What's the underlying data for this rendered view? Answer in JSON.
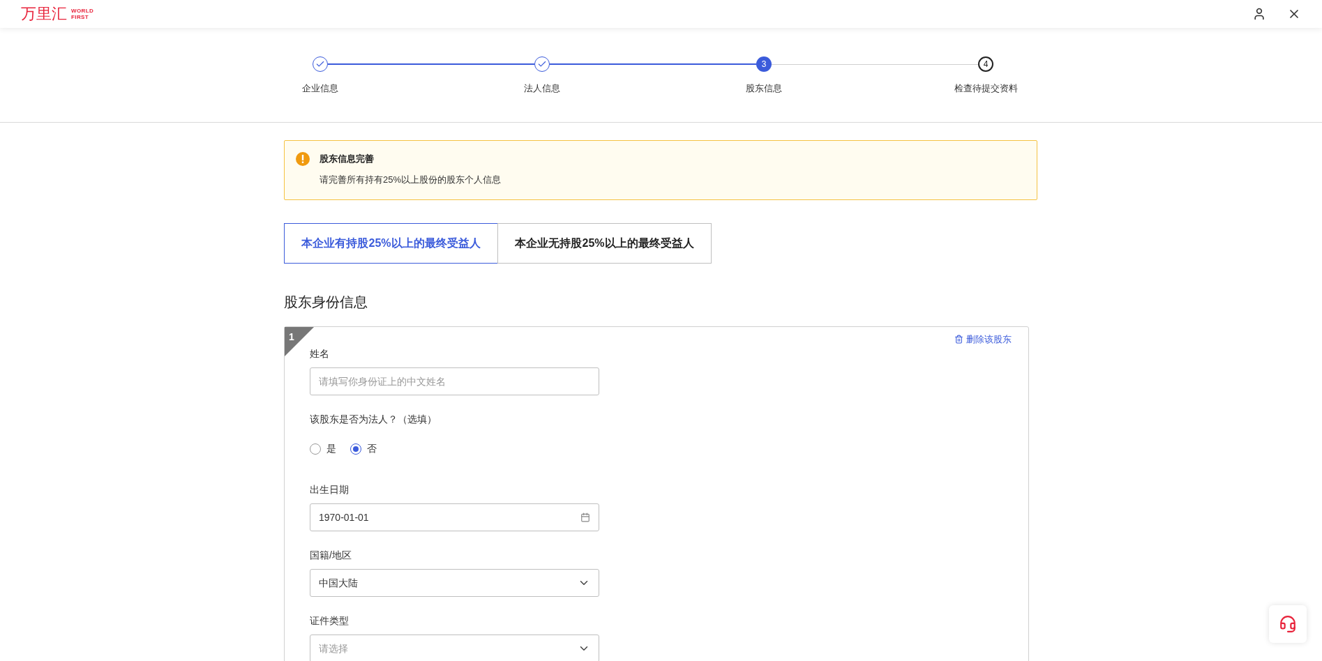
{
  "header": {
    "logo": "万里汇",
    "logo_sub": [
      "WORLD",
      "FIRST"
    ]
  },
  "steps": [
    {
      "label": "企业信息",
      "done": true,
      "selected": false
    },
    {
      "label": "法人信息",
      "done": true,
      "selected": false
    },
    {
      "number": "3",
      "label": "股东信息",
      "done": false,
      "selected": true
    },
    {
      "number": "4",
      "label": "检查待提交资料",
      "done": false,
      "selected": false
    }
  ],
  "alert": {
    "title": "股东信息完善",
    "message": "请完善所有持有25%以上股份的股东个人信息"
  },
  "tabs": [
    {
      "label": "本企业有持股25%以上的最终受益人",
      "selected": true
    },
    {
      "label": "本企业无持股25%以上的最终受益人",
      "selected": false
    }
  ],
  "section_title": "股东身份信息",
  "shareholder": {
    "index": "1",
    "delete_label": "删除该股东",
    "fields": [
      {
        "kind": "text",
        "label": "姓名",
        "placeholder": "请填写你身份证上的中文姓名"
      },
      {
        "kind": "radio",
        "label": "该股东是否为法人？（选填）",
        "options": [
          {
            "label": "是",
            "selected": false
          },
          {
            "label": "否",
            "selected": true
          }
        ]
      },
      {
        "kind": "date",
        "label": "出生日期",
        "value": "1970-01-01"
      },
      {
        "kind": "select",
        "label": "国籍/地区",
        "value": "中国大陆"
      },
      {
        "kind": "select",
        "label": "证件类型",
        "placeholder": "请选择"
      }
    ]
  }
}
